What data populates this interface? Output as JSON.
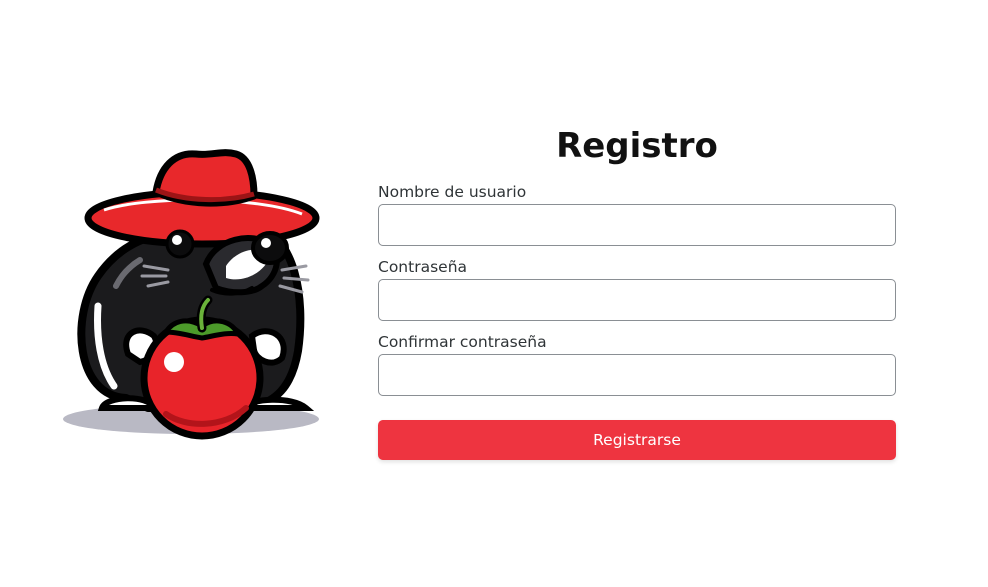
{
  "mascot": {
    "icon": "mole-with-red-hat-holding-tomato-illustration"
  },
  "register": {
    "title": "Registro",
    "fields": [
      {
        "label": "Nombre de usuario",
        "value": "",
        "placeholder": ""
      },
      {
        "label": "Contraseña",
        "value": "",
        "placeholder": ""
      },
      {
        "label": "Confirmar contraseña",
        "value": "",
        "placeholder": ""
      }
    ],
    "submit_label": "Registrarse"
  },
  "colors": {
    "accent": "#ee3440",
    "title_text": "#111111",
    "label_text": "#2f3437",
    "input_border": "#8a8f94"
  }
}
